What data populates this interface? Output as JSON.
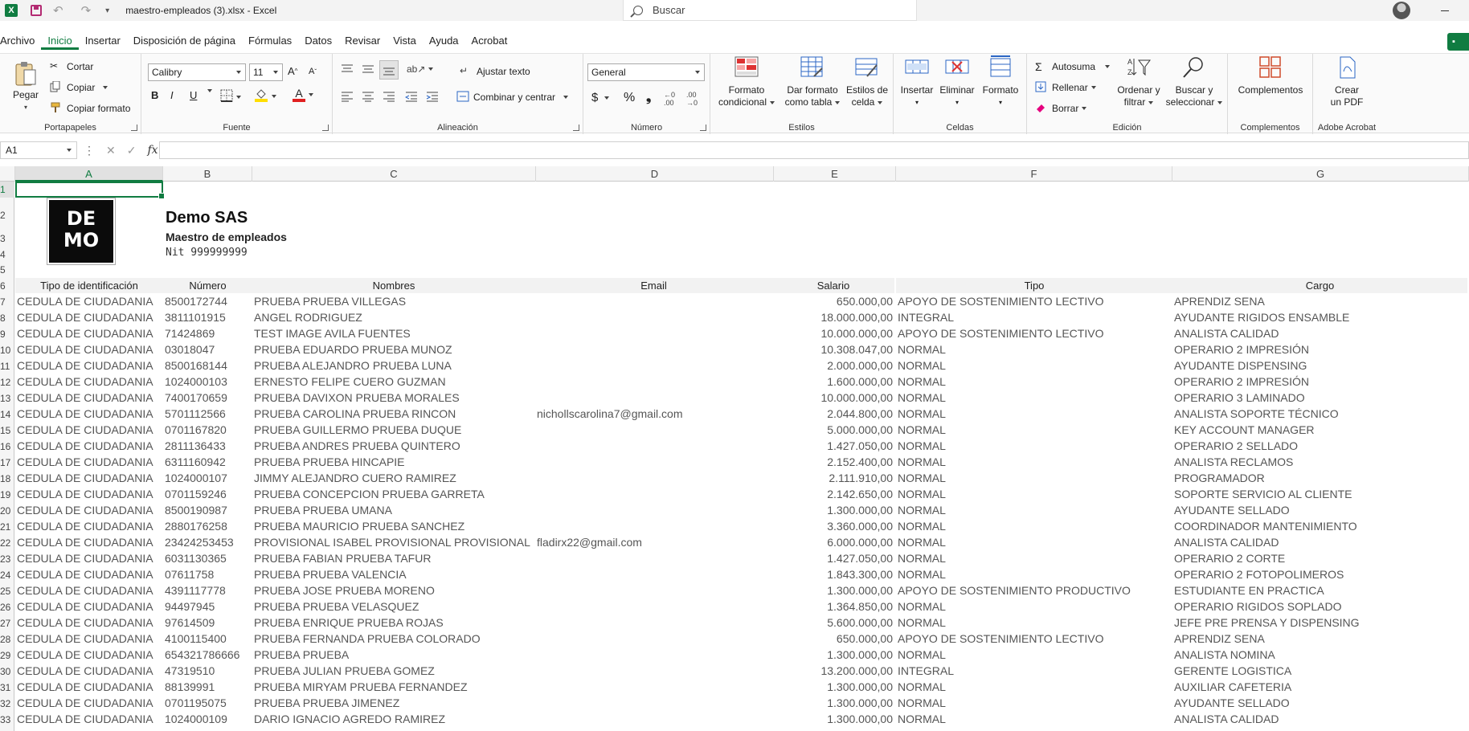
{
  "titlebar": {
    "file_name": "maestro-empleados (3).xlsx",
    "separator": " - ",
    "app_name": "Excel",
    "search_placeholder": "Buscar"
  },
  "menu": {
    "tabs": [
      "Archivo",
      "Inicio",
      "Insertar",
      "Disposición de página",
      "Fórmulas",
      "Datos",
      "Revisar",
      "Vista",
      "Ayuda",
      "Acrobat"
    ],
    "active": "Inicio"
  },
  "ribbon": {
    "clipboard": {
      "paste": "Pegar",
      "cut": "Cortar",
      "copy": "Copiar",
      "format_painter": "Copiar formato",
      "label": "Portapapeles"
    },
    "font": {
      "name": "Calibry",
      "size": "11",
      "label": "Fuente",
      "bold": "B",
      "italic": "I",
      "underline": "U"
    },
    "alignment": {
      "wrap": "Ajustar texto",
      "merge": "Combinar y centrar",
      "label": "Alineación"
    },
    "number": {
      "format": "General",
      "label": "Número",
      "currency": "$",
      "percent": "%",
      "thousands": "❟"
    },
    "styles": {
      "conditional": "Formato\ncondicional",
      "as_table": "Dar formato\ncomo tabla",
      "cell_styles": "Estilos de\ncelda",
      "label": "Estilos"
    },
    "cells": {
      "insert": "Insertar",
      "delete": "Eliminar",
      "format": "Formato",
      "label": "Celdas"
    },
    "editing": {
      "autosum": "Autosuma",
      "fill": "Rellenar",
      "clear": "Borrar",
      "sort": "Ordenar y\nfiltrar",
      "find": "Buscar y\nseleccionar",
      "label": "Edición"
    },
    "addins": {
      "button": "Complementos",
      "label": "Complementos"
    },
    "acrobat": {
      "button": "Crear\nun PDF",
      "label": "Adobe Acrobat"
    }
  },
  "formula_bar": {
    "name_box": "A1",
    "fx": "fx",
    "value": ""
  },
  "columns": [
    "A",
    "B",
    "C",
    "D",
    "E",
    "F",
    "G"
  ],
  "selected_cell": "A1",
  "header_block": {
    "logo_text_line1": "DE",
    "logo_text_line2": "MO",
    "company": "Demo SAS",
    "subtitle": "Maestro de empleados",
    "nit": "Nit 999999999"
  },
  "table_headers": [
    "Tipo de identificación",
    "Número",
    "Nombres",
    "Email",
    "Salario",
    "Tipo",
    "Cargo"
  ],
  "rows": [
    [
      "CEDULA DE CIUDADANIA",
      "8500172744",
      "PRUEBA PRUEBA VILLEGAS",
      "",
      "650.000,00",
      "APOYO DE SOSTENIMIENTO LECTIVO",
      "APRENDIZ SENA"
    ],
    [
      "CEDULA DE CIUDADANIA",
      "3811101915",
      "ANGEL RODRIGUEZ",
      "",
      "18.000.000,00",
      "INTEGRAL",
      "AYUDANTE RIGIDOS ENSAMBLE"
    ],
    [
      "CEDULA DE CIUDADANIA",
      "71424869",
      "TEST IMAGE AVILA FUENTES",
      "",
      "10.000.000,00",
      "APOYO DE SOSTENIMIENTO LECTIVO",
      "ANALISTA CALIDAD"
    ],
    [
      "CEDULA DE CIUDADANIA",
      "03018047",
      "PRUEBA EDUARDO PRUEBA MUNOZ",
      "",
      "10.308.047,00",
      "NORMAL",
      "OPERARIO 2 IMPRESIÓN"
    ],
    [
      "CEDULA DE CIUDADANIA",
      "8500168144",
      "PRUEBA ALEJANDRO PRUEBA LUNA",
      "",
      "2.000.000,00",
      "NORMAL",
      "AYUDANTE DISPENSING"
    ],
    [
      "CEDULA DE CIUDADANIA",
      "1024000103",
      "ERNESTO FELIPE CUERO GUZMAN",
      "",
      "1.600.000,00",
      "NORMAL",
      "OPERARIO 2 IMPRESIÓN"
    ],
    [
      "CEDULA DE CIUDADANIA",
      "7400170659",
      "PRUEBA DAVIXON PRUEBA MORALES",
      "",
      "10.000.000,00",
      "NORMAL",
      "OPERARIO 3 LAMINADO"
    ],
    [
      "CEDULA DE CIUDADANIA",
      "5701112566",
      "PRUEBA CAROLINA PRUEBA RINCON",
      "nichollscarolina7@gmail.com",
      "2.044.800,00",
      "NORMAL",
      "ANALISTA SOPORTE TÉCNICO"
    ],
    [
      "CEDULA DE CIUDADANIA",
      "0701167820",
      "PRUEBA GUILLERMO PRUEBA DUQUE",
      "",
      "5.000.000,00",
      "NORMAL",
      "KEY ACCOUNT MANAGER"
    ],
    [
      "CEDULA DE CIUDADANIA",
      "2811136433",
      "PRUEBA ANDRES PRUEBA QUINTERO",
      "",
      "1.427.050,00",
      "NORMAL",
      "OPERARIO 2 SELLADO"
    ],
    [
      "CEDULA DE CIUDADANIA",
      "6311160942",
      "PRUEBA PRUEBA HINCAPIE",
      "",
      "2.152.400,00",
      "NORMAL",
      "ANALISTA RECLAMOS"
    ],
    [
      "CEDULA DE CIUDADANIA",
      "1024000107",
      "JIMMY ALEJANDRO CUERO RAMIREZ",
      "",
      "2.111.910,00",
      "NORMAL",
      "PROGRAMADOR"
    ],
    [
      "CEDULA DE CIUDADANIA",
      "0701159246",
      "PRUEBA CONCEPCION PRUEBA GARRETA",
      "",
      "2.142.650,00",
      "NORMAL",
      "SOPORTE SERVICIO AL CLIENTE"
    ],
    [
      "CEDULA DE CIUDADANIA",
      "8500190987",
      "PRUEBA PRUEBA UMANA",
      "",
      "1.300.000,00",
      "NORMAL",
      "AYUDANTE SELLADO"
    ],
    [
      "CEDULA DE CIUDADANIA",
      "2880176258",
      "PRUEBA MAURICIO PRUEBA SANCHEZ",
      "",
      "3.360.000,00",
      "NORMAL",
      "COORDINADOR  MANTENIMIENTO"
    ],
    [
      "CEDULA DE CIUDADANIA",
      "23424253453",
      "PROVISIONAL ISABEL PROVISIONAL PROVISIONAL",
      "fladirx22@gmail.com",
      "6.000.000,00",
      "NORMAL",
      "ANALISTA CALIDAD"
    ],
    [
      "CEDULA DE CIUDADANIA",
      "6031130365",
      "PRUEBA FABIAN PRUEBA TAFUR",
      "",
      "1.427.050,00",
      "NORMAL",
      "OPERARIO 2 CORTE"
    ],
    [
      "CEDULA DE CIUDADANIA",
      "07611758",
      "PRUEBA PRUEBA VALENCIA",
      "",
      "1.843.300,00",
      "NORMAL",
      "OPERARIO 2 FOTOPOLIMEROS"
    ],
    [
      "CEDULA DE CIUDADANIA",
      "4391117778",
      "PRUEBA JOSE PRUEBA MORENO",
      "",
      "1.300.000,00",
      "APOYO DE SOSTENIMIENTO PRODUCTIVO",
      "ESTUDIANTE EN PRACTICA"
    ],
    [
      "CEDULA DE CIUDADANIA",
      "94497945",
      "PRUEBA PRUEBA VELASQUEZ",
      "",
      "1.364.850,00",
      "NORMAL",
      "OPERARIO RIGIDOS SOPLADO"
    ],
    [
      "CEDULA DE CIUDADANIA",
      "97614509",
      "PRUEBA ENRIQUE PRUEBA ROJAS",
      "",
      "5.600.000,00",
      "NORMAL",
      "JEFE PRE PRENSA Y DISPENSING"
    ],
    [
      "CEDULA DE CIUDADANIA",
      "4100115400",
      "PRUEBA FERNANDA PRUEBA COLORADO",
      "",
      "650.000,00",
      "APOYO DE SOSTENIMIENTO LECTIVO",
      "APRENDIZ SENA"
    ],
    [
      "CEDULA DE CIUDADANIA",
      "654321786666",
      "PRUEBA PRUEBA",
      "",
      "1.300.000,00",
      "NORMAL",
      "ANALISTA NOMINA"
    ],
    [
      "CEDULA DE CIUDADANIA",
      "47319510",
      "PRUEBA JULIAN PRUEBA GOMEZ",
      "",
      "13.200.000,00",
      "INTEGRAL",
      "GERENTE LOGISTICA"
    ],
    [
      "CEDULA DE CIUDADANIA",
      "88139991",
      "PRUEBA MIRYAM PRUEBA FERNANDEZ",
      "",
      "1.300.000,00",
      "NORMAL",
      "AUXILIAR CAFETERIA"
    ],
    [
      "CEDULA DE CIUDADANIA",
      "0701195075",
      "PRUEBA PRUEBA JIMENEZ",
      "",
      "1.300.000,00",
      "NORMAL",
      "AYUDANTE SELLADO"
    ],
    [
      "CEDULA DE CIUDADANIA",
      "1024000109",
      "DARIO IGNACIO AGREDO RAMIREZ",
      "",
      "1.300.000,00",
      "NORMAL",
      "ANALISTA CALIDAD"
    ]
  ],
  "row_numbers": [
    "1",
    "2",
    "3",
    "4",
    "5",
    "6",
    "7",
    "8",
    "9",
    "10",
    "11",
    "12",
    "13",
    "14",
    "15",
    "16",
    "17",
    "18",
    "19",
    "20",
    "21",
    "22",
    "23",
    "24",
    "25",
    "26",
    "27",
    "28",
    "29",
    "30",
    "31",
    "32",
    "33"
  ]
}
